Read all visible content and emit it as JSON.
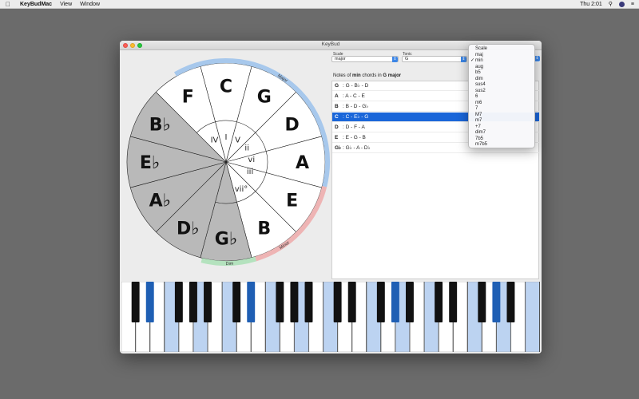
{
  "menubar": {
    "app_name": "KeyBudMac",
    "menus": [
      "View",
      "Window"
    ],
    "clock": "Thu 2:01"
  },
  "window": {
    "title": "KeyBud"
  },
  "circle": {
    "arc_labels": [
      "Major",
      "Minor",
      "Dim"
    ],
    "arc_colors": {
      "major": "#a7c8ec",
      "minor": "#eeb4b4",
      "dim": "#b4e2be"
    },
    "outer_notes": [
      "C",
      "G",
      "D",
      "A",
      "E",
      "B",
      "G♭",
      "D♭",
      "A♭",
      "E♭",
      "B♭",
      "F"
    ],
    "roman_numerals": [
      "IV",
      "I",
      "V",
      "ii",
      "vi",
      "iii",
      "vii°"
    ],
    "scale_fill": "#ffffff",
    "non_scale_fill": "#b9b9b9"
  },
  "controls": {
    "scale_label": "Scale",
    "scale_value": "major",
    "tonic_label": "Tonic",
    "tonic_value": "G"
  },
  "notes_heading": {
    "prefix": "Notes of",
    "quality": "min",
    "middle": "chords in",
    "key": "G major"
  },
  "chords": [
    {
      "root": "G",
      "notes": ": G - B♭ - D",
      "selected": false
    },
    {
      "root": "A",
      "notes": ": A - C - E",
      "selected": false
    },
    {
      "root": "B",
      "notes": ": B - D - G♭",
      "selected": false
    },
    {
      "root": "C",
      "notes": ": C - E♭ - G",
      "selected": true
    },
    {
      "root": "D",
      "notes": ": D - F - A",
      "selected": false
    },
    {
      "root": "E",
      "notes": ": E - G - B",
      "selected": false
    },
    {
      "root": "G♭",
      "notes": ": G♭ - A - D♭",
      "selected": false
    }
  ],
  "dropdown": {
    "items": [
      "Scale",
      "maj",
      "min",
      "aug",
      "b5",
      "dim",
      "sus4",
      "sus2",
      "6",
      "m6",
      "7",
      "M7",
      "m7",
      "+7",
      "dim7",
      "7b5",
      "m7b5"
    ],
    "checked": "min"
  },
  "piano": {
    "white_key_count": 29,
    "highlight_color": "#bcd3f1",
    "black_highlight_color": "#1f5fb4",
    "highlighted_white": [
      3,
      5,
      7,
      10,
      12,
      14,
      17,
      19,
      21,
      24,
      26,
      28
    ],
    "highlighted_black": [
      1,
      6,
      13,
      18,
      25
    ]
  }
}
